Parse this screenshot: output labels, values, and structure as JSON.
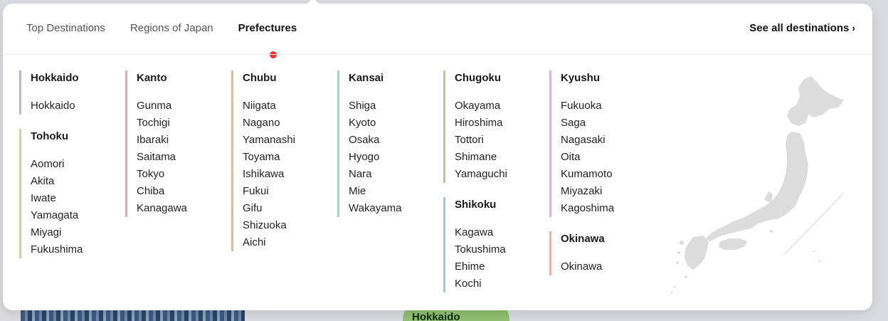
{
  "background": {
    "map_label": "Hokkaido"
  },
  "menu": {
    "tabs": [
      {
        "label": "Top Destinations",
        "active": false
      },
      {
        "label": "Regions of Japan",
        "active": false
      },
      {
        "label": "Prefectures",
        "active": true
      }
    ],
    "see_all": "See all destinations",
    "see_all_chevron": "›",
    "accent_color": "#e53935"
  },
  "columns": [
    [
      {
        "name": "Hokkaido",
        "color": "#a9bcd0",
        "prefectures": [
          "Hokkaido"
        ]
      },
      {
        "name": "Tohoku",
        "color": "#d8cf94",
        "prefectures": [
          "Aomori",
          "Akita",
          "Iwate",
          "Yamagata",
          "Miyagi",
          "Fukushima"
        ]
      }
    ],
    [
      {
        "name": "Kanto",
        "color": "#e0a9b8",
        "prefectures": [
          "Gunma",
          "Tochigi",
          "Ibaraki",
          "Saitama",
          "Tokyo",
          "Chiba",
          "Kanagawa"
        ]
      }
    ],
    [
      {
        "name": "Chubu",
        "color": "#eab699",
        "prefectures": [
          "Niigata",
          "Nagano",
          "Yamanashi",
          "Toyama",
          "Ishikawa",
          "Fukui",
          "Gifu",
          "Shizuoka",
          "Aichi"
        ]
      }
    ],
    [
      {
        "name": "Kansai",
        "color": "#a6d1cf",
        "prefectures": [
          "Shiga",
          "Kyoto",
          "Osaka",
          "Hyogo",
          "Nara",
          "Mie",
          "Wakayama"
        ]
      }
    ],
    [
      {
        "name": "Chugoku",
        "color": "#b2cc9c",
        "prefectures": [
          "Okayama",
          "Hiroshima",
          "Tottori",
          "Shimane",
          "Yamaguchi"
        ]
      },
      {
        "name": "Shikoku",
        "color": "#9dc8dd",
        "prefectures": [
          "Kagawa",
          "Tokushima",
          "Ehime",
          "Kochi"
        ]
      }
    ],
    [
      {
        "name": "Kyushu",
        "color": "#dfaede",
        "prefectures": [
          "Fukuoka",
          "Saga",
          "Nagasaki",
          "Oita",
          "Kumamoto",
          "Miyazaki",
          "Kagoshima"
        ]
      },
      {
        "name": "Okinawa",
        "color": "#f0b0a5",
        "prefectures": [
          "Okinawa"
        ]
      }
    ]
  ],
  "map": {
    "icon": "japan-map-icon",
    "fill": "#dcdcdc"
  }
}
